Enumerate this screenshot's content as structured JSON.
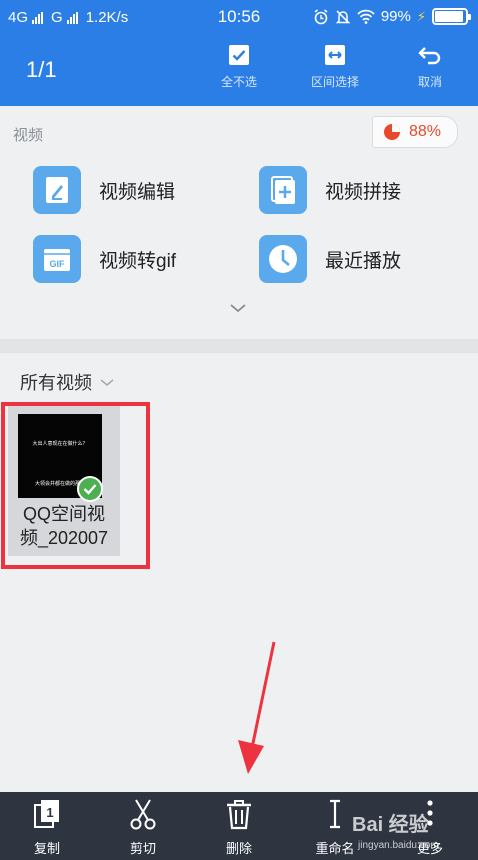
{
  "status_bar": {
    "network1": "4G",
    "network2": "G",
    "speed": "1.2K/s",
    "time": "10:56",
    "battery": "99%"
  },
  "header": {
    "counter": "1/1",
    "actions": [
      {
        "label": "全不选",
        "icon": "checkbox-icon"
      },
      {
        "label": "区间选择",
        "icon": "range-select-icon"
      },
      {
        "label": "取消",
        "icon": "return-icon"
      }
    ]
  },
  "tools": {
    "section_label": "视频",
    "storage_percent": "88%",
    "items": [
      {
        "label": "视频编辑",
        "icon": "video-edit-icon"
      },
      {
        "label": "视频拼接",
        "icon": "video-merge-icon"
      },
      {
        "label": "视频转gif",
        "icon": "gif-icon"
      },
      {
        "label": "最近播放",
        "icon": "clock-icon"
      }
    ]
  },
  "videos": {
    "filter_label": "所有视频",
    "items": [
      {
        "name_line1": "QQ空间视",
        "name_line2": "频_202007",
        "thumb_caption1": "大出人意现在在做什么？",
        "thumb_caption2": "大领会并都在做的那些"
      }
    ]
  },
  "bottom_bar": {
    "actions": [
      {
        "label": "复制",
        "icon": "copy-icon"
      },
      {
        "label": "剪切",
        "icon": "scissors-icon"
      },
      {
        "label": "删除",
        "icon": "trash-icon"
      },
      {
        "label": "重命名",
        "icon": "rename-icon"
      },
      {
        "label": "更多",
        "icon": "more-icon"
      }
    ]
  },
  "watermark": {
    "brand": "Bai 经验",
    "url": "jingyan.baidu.com"
  },
  "colors": {
    "header_blue": "#2a7ee6",
    "tile_blue": "#59a9ec",
    "highlight_red": "#ee3340",
    "check_green": "#4caf50",
    "bottom_bar": "#2e3440"
  }
}
